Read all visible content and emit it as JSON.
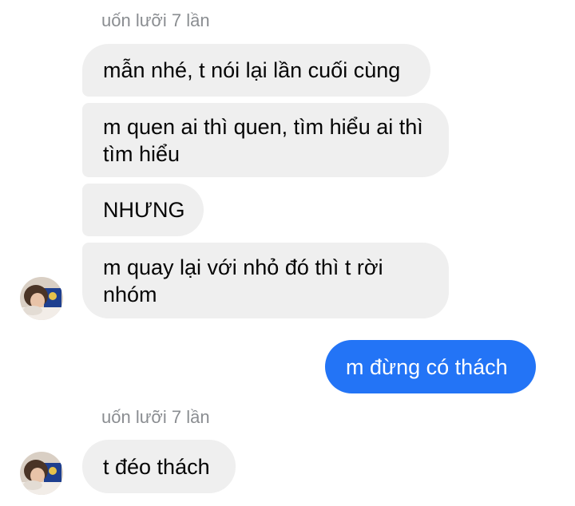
{
  "conversation": {
    "group1": {
      "sender": "uốn lưỡi 7 lần",
      "messages": [
        "mẫn nhé, t nói lại lần cuối cùng",
        "m quen ai thì quen, tìm hiểu ai thì tìm hiểu",
        "NHƯNG",
        "m quay lại với nhỏ đó thì t rời nhóm"
      ]
    },
    "outgoing": {
      "message": "m đừng có thách"
    },
    "group2": {
      "sender": "uốn lưỡi 7 lần",
      "messages": [
        "t đéo thách"
      ]
    }
  },
  "colors": {
    "incoming_bubble": "#efefef",
    "outgoing_bubble": "#2374f6",
    "sender_name": "#8a8d91"
  },
  "icons": [
    "avatar-photo"
  ]
}
